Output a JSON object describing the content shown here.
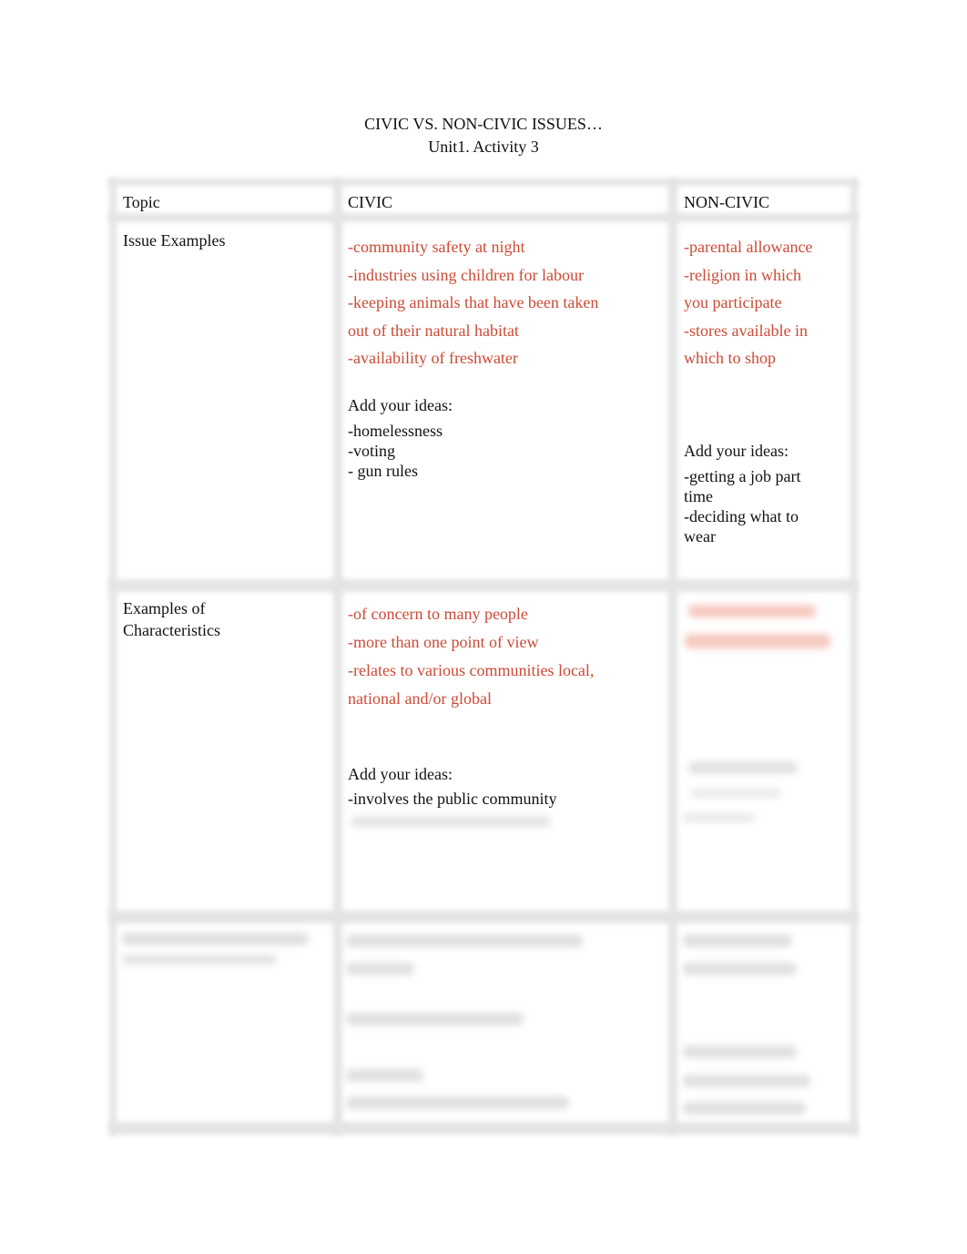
{
  "document": {
    "title": "CIVIC VS. NON-CIVIC ISSUES…",
    "subtitle": "Unit1. Activity 3"
  },
  "table": {
    "headers": [
      "Topic",
      "CIVIC",
      "NON-CIVIC"
    ],
    "rows": [
      {
        "topic": "Issue Examples",
        "civic_given": [
          "-community safety at night",
          "-industries using children for labour",
          "-keeping animals that have been taken",
          "out of their natural habitat",
          "-availability of freshwater"
        ],
        "civic_ideas_label": "Add your ideas:",
        "civic_ideas": [
          "-homelessness",
          "-voting",
          "- gun rules"
        ],
        "noncivic_given": [
          "-parental allowance",
          "-religion in which",
          "you participate",
          "-stores available in",
          "which to shop"
        ],
        "noncivic_ideas_label": "Add your ideas:",
        "noncivic_ideas": [
          "-getting a job part",
          "time",
          "-deciding what to",
          "wear"
        ]
      },
      {
        "topic_lines": [
          "Examples of",
          "Characteristics"
        ],
        "civic_given": [
          "-of concern to many people",
          "-more than one point of view",
          "-relates to various communities local,",
          "national and/or global"
        ],
        "civic_ideas_label": "Add your ideas:",
        "civic_ideas": [
          "-involves the public community"
        ],
        "noncivic_note": "content obscured"
      },
      {
        "note": "row content obscured"
      }
    ],
    "colors": {
      "given_text": "#cc4a36",
      "body_text": "#111111",
      "grid": "#e4e4e4"
    }
  }
}
